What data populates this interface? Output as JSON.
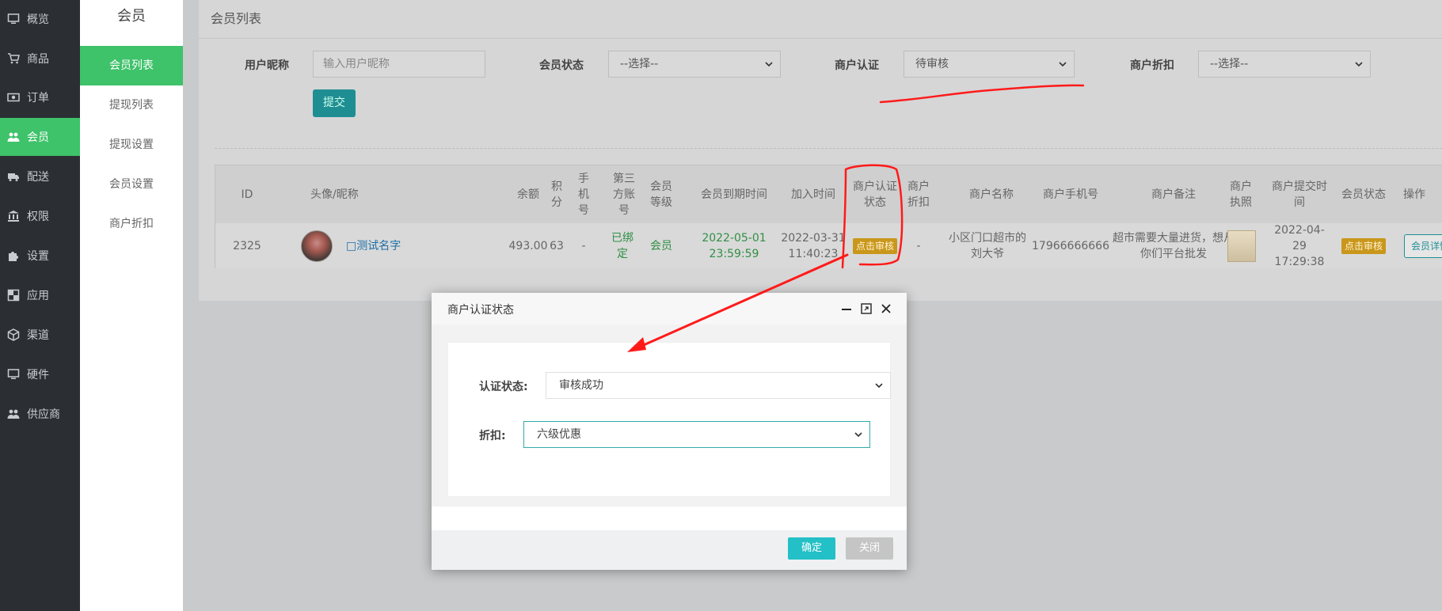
{
  "nav": {
    "items": [
      {
        "label": "概览",
        "icon": "monitor-icon"
      },
      {
        "label": "商品",
        "icon": "cart-icon"
      },
      {
        "label": "订单",
        "icon": "money-icon"
      },
      {
        "label": "会员",
        "icon": "users-icon"
      },
      {
        "label": "配送",
        "icon": "truck-icon"
      },
      {
        "label": "权限",
        "icon": "bank-icon"
      },
      {
        "label": "设置",
        "icon": "puzzle-icon"
      },
      {
        "label": "应用",
        "icon": "grid-icon"
      },
      {
        "label": "渠道",
        "icon": "cube-icon"
      },
      {
        "label": "硬件",
        "icon": "monitor-icon"
      },
      {
        "label": "供应商",
        "icon": "users-icon"
      }
    ],
    "active_index": 3
  },
  "submenu": {
    "title": "会员",
    "items": [
      "会员列表",
      "提现列表",
      "提现设置",
      "会员设置",
      "商户折扣"
    ],
    "active_index": 0
  },
  "page": {
    "breadcrumb": "会员列表"
  },
  "filters": {
    "nickname_label": "用户昵称",
    "nickname_placeholder": "输入用户昵称",
    "member_status_label": "会员状态",
    "member_status_value": "--选择--",
    "merchant_auth_label": "商户认证",
    "merchant_auth_value": "待审核",
    "merchant_discount_label": "商户折扣",
    "merchant_discount_value": "--选择--",
    "submit_label": "提交"
  },
  "table": {
    "headers": [
      "ID",
      "头像/昵称",
      "余额",
      "积分",
      "手机号",
      "第三方账号",
      "会员等级",
      "会员到期时间",
      "加入时间",
      "商户认证状态",
      "商户折扣",
      "商户名称",
      "商户手机号",
      "商户备注",
      "商户执照",
      "商户提交时间",
      "会员状态",
      "操作"
    ],
    "rows": [
      {
        "id": "2325",
        "nickname": "□测试名字",
        "balance": "493.00",
        "points": "63",
        "phone": "-",
        "third_party": "已绑定",
        "level": "会员",
        "expire": "2022-05-01 23:59:59",
        "joined": "2022-03-31 11:40:23",
        "auth_status": "点击审核",
        "discount": "-",
        "merchant_name": "小区门口超市的刘大爷",
        "merchant_phone": "17966666666",
        "remark": "超市需要大量进货，想从你们平台批发",
        "submit_time": "2022-04-29 17:29:38",
        "member_status": "点击审核",
        "action": "会员详情"
      }
    ]
  },
  "modal": {
    "title": "商户认证状态",
    "auth_label": "认证状态:",
    "auth_value": "审核成功",
    "discount_label": "折扣:",
    "discount_value": "六级优惠",
    "ok_label": "确定",
    "close_label": "关闭"
  },
  "colors": {
    "accent_green": "#3ec26a",
    "teal": "#23c0c7",
    "annotation_red": "#ff1a1a"
  }
}
